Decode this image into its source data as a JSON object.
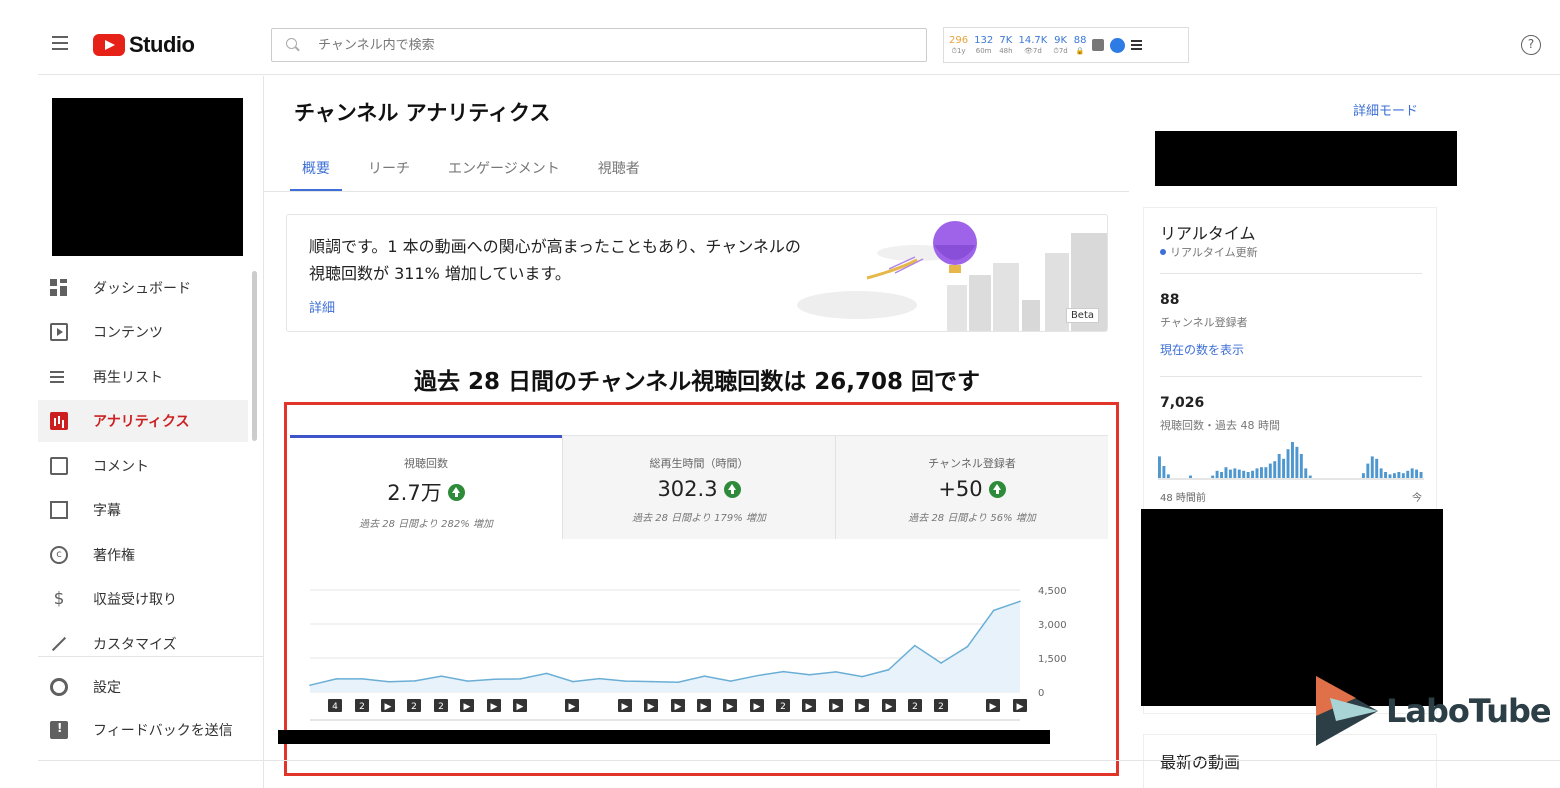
{
  "header": {
    "logo_text": "Studio",
    "search_placeholder": "チャンネル内で検索",
    "ext_stats": [
      {
        "value": "296",
        "sub": "⏱1y"
      },
      {
        "value": "132",
        "sub": "60m"
      },
      {
        "value": "7K",
        "sub": "48h"
      },
      {
        "value": "14.7K",
        "sub": "👁7d"
      },
      {
        "value": "9K",
        "sub": "⏱7d"
      },
      {
        "value": "88",
        "sub": "🔒"
      }
    ],
    "help": "?"
  },
  "sidebar": {
    "items": [
      {
        "label": "ダッシュボード",
        "icon": "dashboard-icon"
      },
      {
        "label": "コンテンツ",
        "icon": "content-icon"
      },
      {
        "label": "再生リスト",
        "icon": "playlist-icon"
      },
      {
        "label": "アナリティクス",
        "icon": "analytics-icon",
        "active": true
      },
      {
        "label": "コメント",
        "icon": "comment-icon"
      },
      {
        "label": "字幕",
        "icon": "subtitle-icon"
      },
      {
        "label": "著作権",
        "icon": "copyright-icon"
      },
      {
        "label": "収益受け取り",
        "icon": "dollar-icon"
      },
      {
        "label": "カスタマイズ",
        "icon": "wand-icon"
      },
      {
        "label": "設定",
        "icon": "gear-icon"
      },
      {
        "label": "フィードバックを送信",
        "icon": "feedback-icon"
      }
    ]
  },
  "main": {
    "title": "チャンネル アナリティクス",
    "advanced_mode": "詳細モード",
    "tabs": [
      "概要",
      "リーチ",
      "エンゲージメント",
      "視聴者"
    ],
    "insight": {
      "text": "順調です。1 本の動画への関心が高まったこともあり、チャンネルの視聴回数が 311% 増加しています。",
      "link": "詳細",
      "badge": "Beta"
    },
    "headline": "過去 28 日間のチャンネル視聴回数は 26,708 回です",
    "metrics": [
      {
        "label": "視聴回数",
        "value": "2.7万",
        "sub": "過去 28 日間より 282% 増加"
      },
      {
        "label": "総再生時間（時間）",
        "value": "302.3",
        "sub": "過去 28 日間より 179% 増加"
      },
      {
        "label": "チャンネル登録者",
        "value": "+50",
        "sub": "過去 28 日間より 56% 増加"
      }
    ],
    "chart_markers": [
      "4",
      "2",
      "▶",
      "2",
      "2",
      "▶",
      "▶",
      "▶",
      "▶",
      "▶",
      "▶",
      "▶",
      "▶",
      "▶",
      "▶",
      "2",
      "▶",
      "▶",
      "▶",
      "▶",
      "2",
      "2",
      "▶",
      "▶"
    ]
  },
  "chart_data": {
    "type": "area",
    "yticks": [
      "4,500",
      "3,000",
      "1,500",
      "0"
    ],
    "ylim": [
      0,
      4500
    ],
    "values": [
      300,
      580,
      580,
      450,
      490,
      700,
      480,
      560,
      580,
      820,
      460,
      590,
      480,
      460,
      430,
      700,
      480,
      720,
      900,
      760,
      890,
      680,
      980,
      2050,
      1280,
      2000,
      3600,
      4000
    ],
    "color": "#6aaed6"
  },
  "realtime": {
    "title": "リアルタイム",
    "live": "リアルタイム更新",
    "subs_value": "88",
    "subs_label": "チャンネル登録者",
    "show_count": "現在の数を表示",
    "views_value": "7,026",
    "views_label": "視聴回数・過去 48 時間",
    "bars": [
      18,
      10,
      3,
      0,
      0,
      0,
      0,
      2,
      0,
      0,
      0,
      0,
      2,
      6,
      5,
      9,
      7,
      8,
      7,
      6,
      5,
      6,
      8,
      9,
      9,
      12,
      14,
      20,
      16,
      24,
      30,
      26,
      20,
      8,
      2,
      0,
      0,
      0,
      0,
      0,
      0,
      0,
      0,
      0,
      0,
      0,
      4,
      12,
      18,
      16,
      8,
      5,
      3,
      4,
      5,
      4,
      6,
      8,
      7,
      5
    ],
    "axis_left": "48 時間前",
    "axis_right": "今",
    "latest_title": "最新の動画"
  },
  "watermark": "LaboTube"
}
